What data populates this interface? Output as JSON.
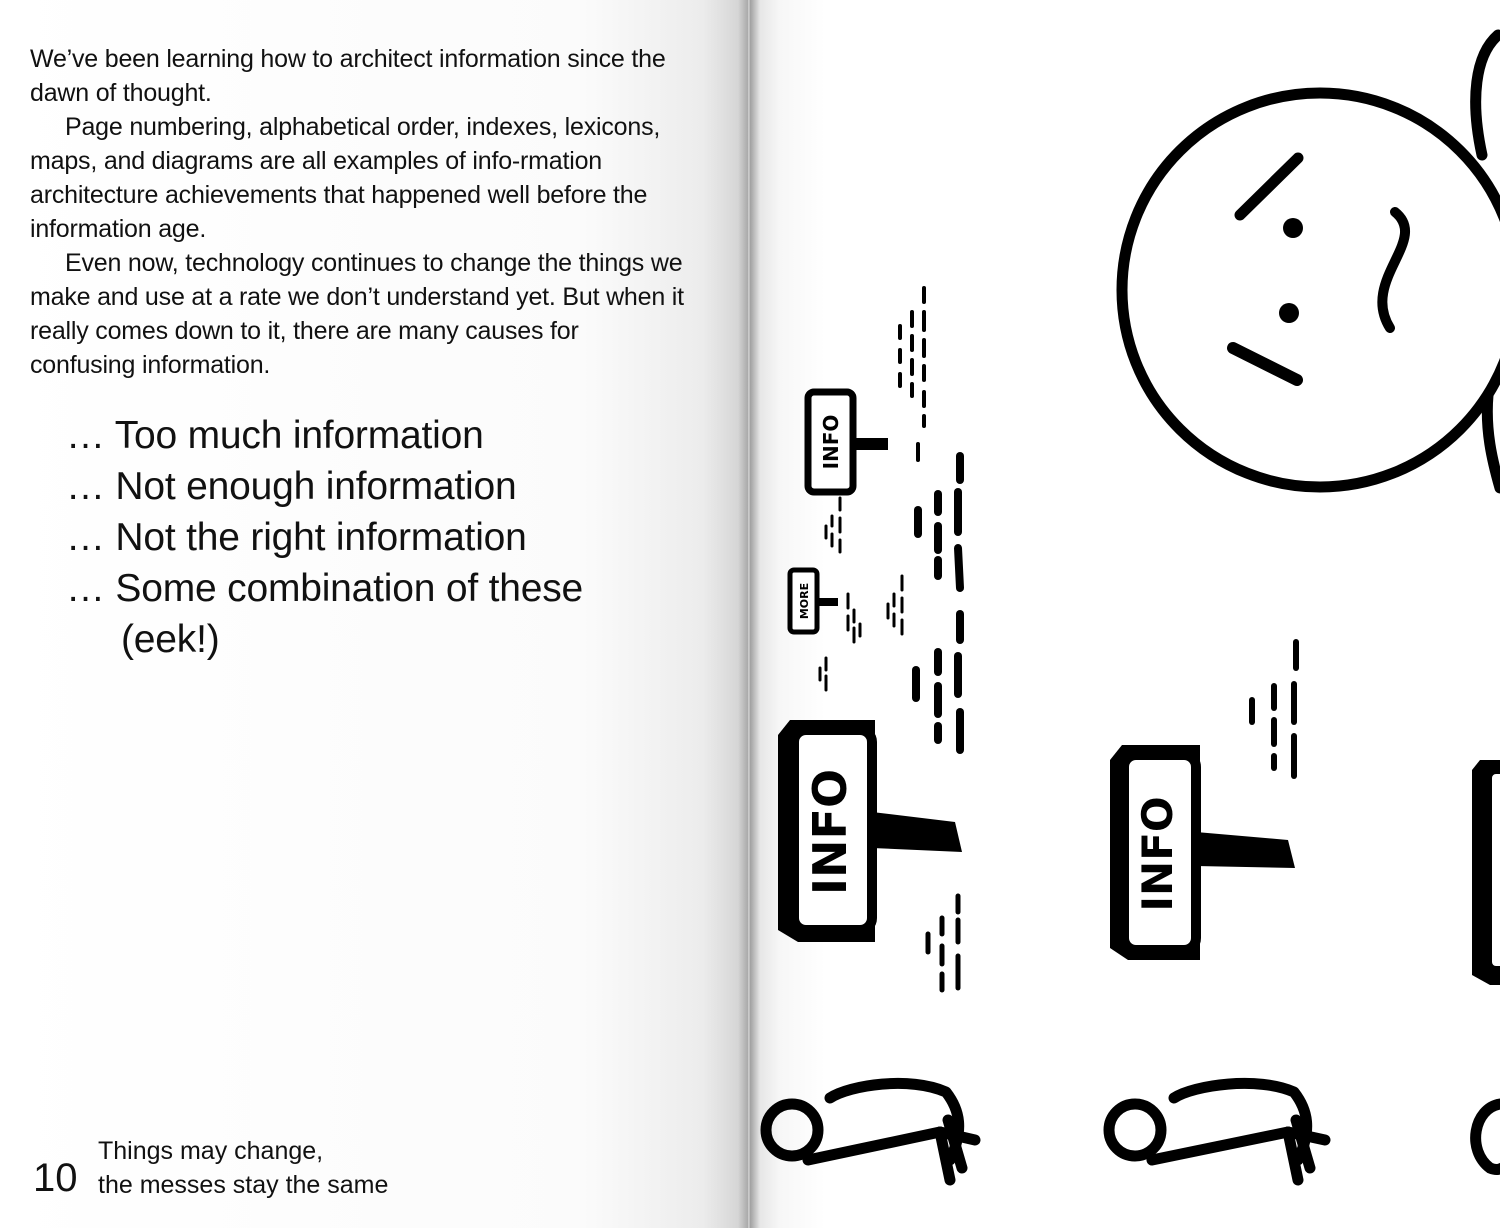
{
  "left_page": {
    "paragraphs": [
      "We’ve been learning how to architect information since the dawn of thought.",
      "Page numbering, alphabetical order, indexes, lexicons, maps, and diagrams are all examples of info-rmation architecture achievements that happened well before the information age.",
      "Even now, technology continues to change the things we make and use at a rate we don’t understand yet. But when it really comes down to it, there are many causes for confusing information."
    ],
    "causes": [
      "… Too much information",
      "… Not enough information",
      "… Not the right information",
      "… Some combination of these"
    ],
    "aside": "(eek!)",
    "page_number": "10",
    "running_head": [
      "Things may change,",
      "the messes stay the same"
    ]
  },
  "right_page": {
    "sign_labels": [
      "INFO",
      "MORE",
      "INFO",
      "INFO"
    ],
    "icons": [
      "sad-face-icon",
      "info-sign-icon",
      "more-sign-icon",
      "person-icon"
    ]
  }
}
